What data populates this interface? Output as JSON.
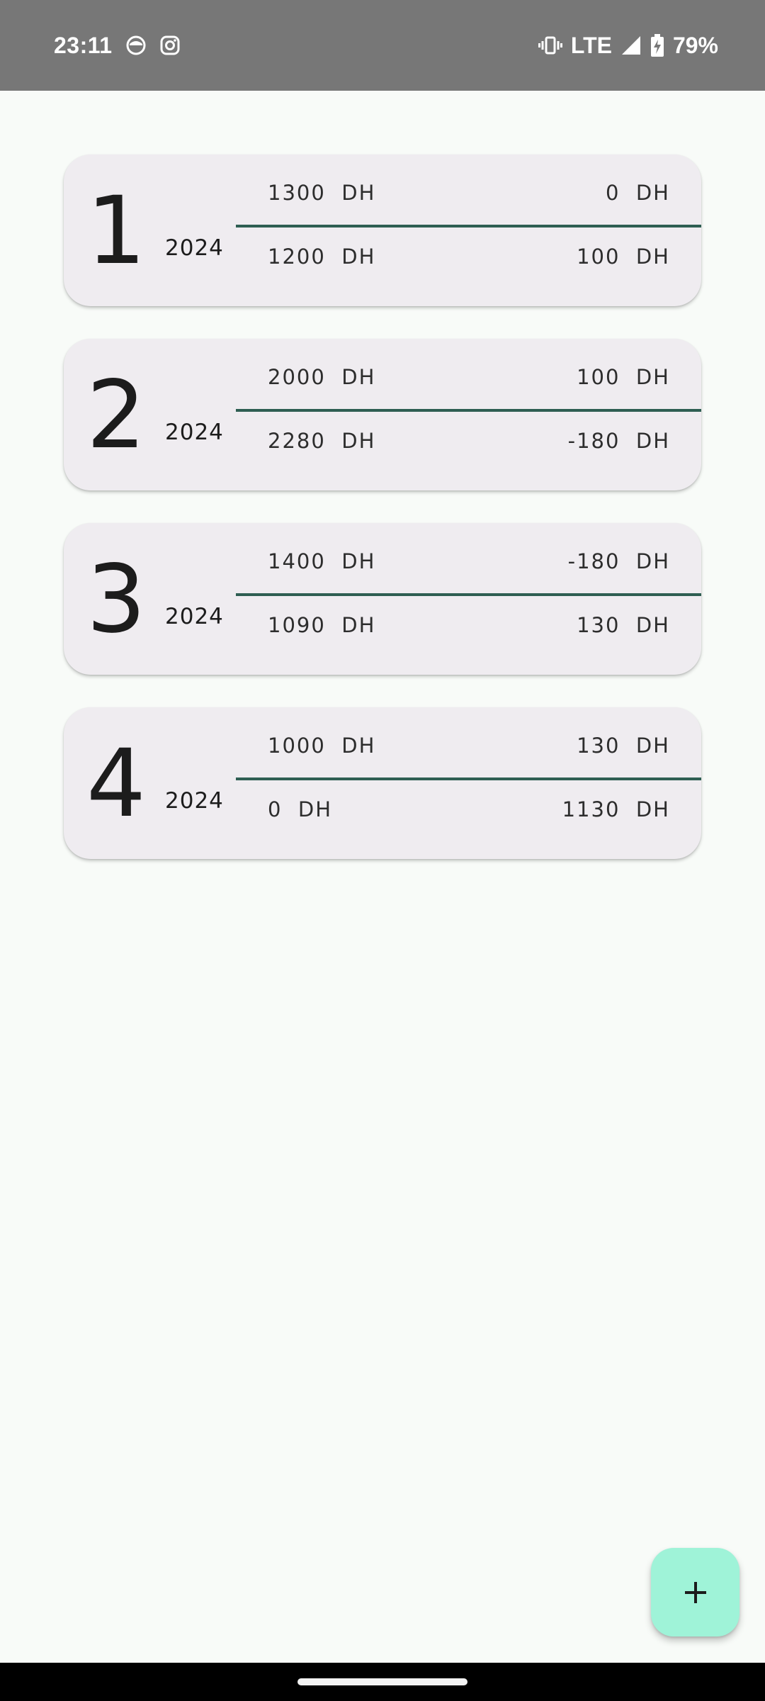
{
  "status_bar": {
    "time": "23:11",
    "network": "LTE",
    "battery": "79%",
    "icons": [
      "face-mask-icon",
      "instagram-icon",
      "vibrate-icon",
      "signal-icon",
      "battery-charging-icon"
    ]
  },
  "cards": [
    {
      "number": "1",
      "year": "2024",
      "top_left": "1300  DH",
      "top_right": "0  DH",
      "bottom_left": "1200  DH",
      "bottom_right": "100  DH"
    },
    {
      "number": "2",
      "year": "2024",
      "top_left": "2000  DH",
      "top_right": "100  DH",
      "bottom_left": "2280  DH",
      "bottom_right": "-180  DH"
    },
    {
      "number": "3",
      "year": "2024",
      "top_left": "1400  DH",
      "top_right": "-180  DH",
      "bottom_left": "1090  DH",
      "bottom_right": "130  DH"
    },
    {
      "number": "4",
      "year": "2024",
      "top_left": "1000  DH",
      "top_right": "130  DH",
      "bottom_left": "0  DH",
      "bottom_right": "1130  DH"
    }
  ],
  "fab": {
    "icon": "plus-icon"
  },
  "colors": {
    "background": "#f8fbf8",
    "card": "#efecf0",
    "divider": "#2e5e52",
    "fab": "#9ff3d8",
    "status_bar": "#777777"
  }
}
